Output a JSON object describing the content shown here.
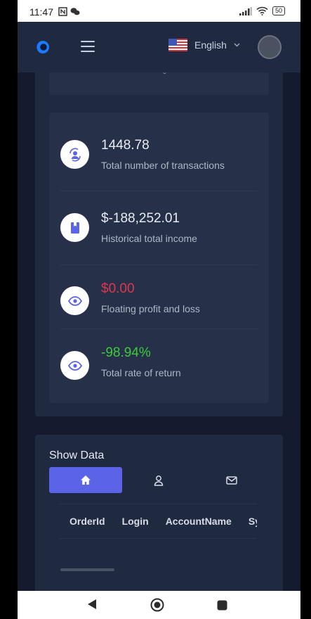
{
  "status_bar": {
    "time": "11:47",
    "battery": "50",
    "icons": [
      "n-icon",
      "wechat-icon",
      "signal-icon",
      "wifi-icon",
      "battery-icon"
    ]
  },
  "header": {
    "language": "English",
    "icons": [
      "app-logo",
      "menu-icon",
      "us-flag-icon",
      "chevron-down-icon",
      "avatar"
    ]
  },
  "stats": [
    {
      "value": "1448.78",
      "label": "Total number of transactions",
      "icon": "user-cycle-icon",
      "value_color": "#e7ebf3"
    },
    {
      "value": "$-188,252.01",
      "label": "Historical total income",
      "icon": "book-icon",
      "value_color": "#e7ebf3"
    },
    {
      "value": "$0.00",
      "label": "Floating profit and loss",
      "icon": "eye-icon",
      "value_color": "#e0354f"
    },
    {
      "value": "-98.94%",
      "label": "Total rate of return",
      "icon": "eye-icon",
      "value_color": "#3ec93a"
    }
  ],
  "data_section": {
    "title": "Show Data",
    "tabs": [
      {
        "icon": "home-icon",
        "active": true
      },
      {
        "icon": "user-icon",
        "active": false
      },
      {
        "icon": "mail-icon",
        "active": false
      }
    ],
    "columns": [
      "OrderId",
      "Login",
      "AccountName",
      "Sy"
    ]
  },
  "colors": {
    "accent": "#5b63e6",
    "background": "#141b2e",
    "card": "#1f2940",
    "negative": "#e0354f",
    "positive": "#3ec93a"
  }
}
